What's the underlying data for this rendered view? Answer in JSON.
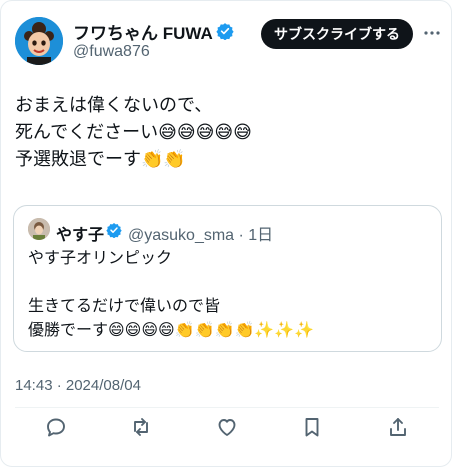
{
  "author": {
    "display_name": "フワちゃん FUWA",
    "handle": "@fuwa876",
    "verified_icon": "verified-badge"
  },
  "header": {
    "subscribe_label": "サブスクライブする",
    "more_icon": "more-icon"
  },
  "tweet": {
    "lines": [
      "おまえは偉くないので、",
      "死んでくださーい😅😅😅😅😅",
      "予選敗退でーす👏👏"
    ]
  },
  "quote": {
    "display_name": "やす子",
    "handle_time": "@yasuko_sma · 1日",
    "lines": [
      "やす子オリンピック",
      "",
      "生きてるだけで偉いので皆",
      "優勝でーす😄😄😄😄👏👏👏👏✨✨✨"
    ]
  },
  "meta": {
    "timestamp": "14:43 · 2024/08/04"
  },
  "actions": [
    "reply-icon",
    "retweet-icon",
    "like-icon",
    "bookmark-icon",
    "share-icon"
  ],
  "colors": {
    "verified": "#1d9bf0",
    "text_secondary": "#536471",
    "button_bg": "#0f1419"
  }
}
